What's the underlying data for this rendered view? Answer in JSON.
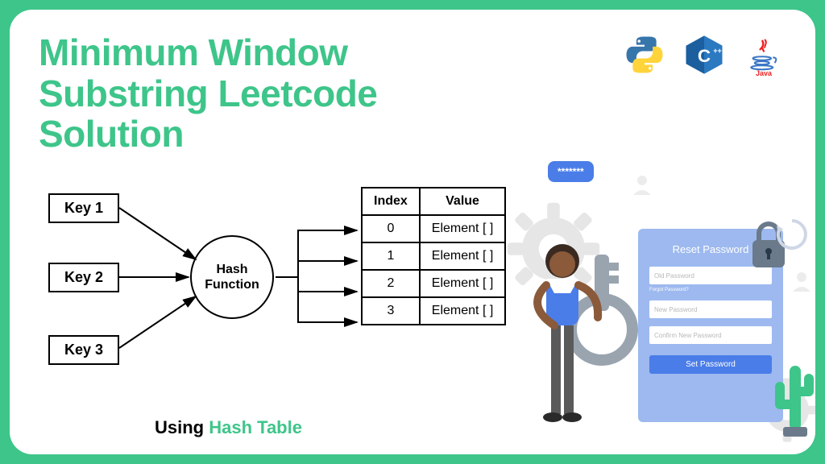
{
  "title": "Minimum Window Substring Leetcode Solution",
  "languages": {
    "python": "python-icon",
    "cpp": "cpp-icon",
    "java": "java-icon"
  },
  "diagram": {
    "keys": [
      "Key 1",
      "Key 2",
      "Key 3"
    ],
    "hash_label": "Hash Function",
    "table": {
      "headers": {
        "index": "Index",
        "value": "Value"
      },
      "rows": [
        {
          "index": "0",
          "value": "Element [ ]"
        },
        {
          "index": "1",
          "value": "Element [ ]"
        },
        {
          "index": "2",
          "value": "Element [ ]"
        },
        {
          "index": "3",
          "value": "Element [ ]"
        }
      ]
    },
    "caption_prefix": "Using ",
    "caption_highlight": "Hash Table"
  },
  "illustration": {
    "speech": "*******",
    "form": {
      "title": "Reset Password",
      "old_placeholder": "Old Password",
      "forgot": "Forgot Password?",
      "new_placeholder": "New Password",
      "confirm_placeholder": "Confirm New Password",
      "button": "Set Password"
    }
  }
}
